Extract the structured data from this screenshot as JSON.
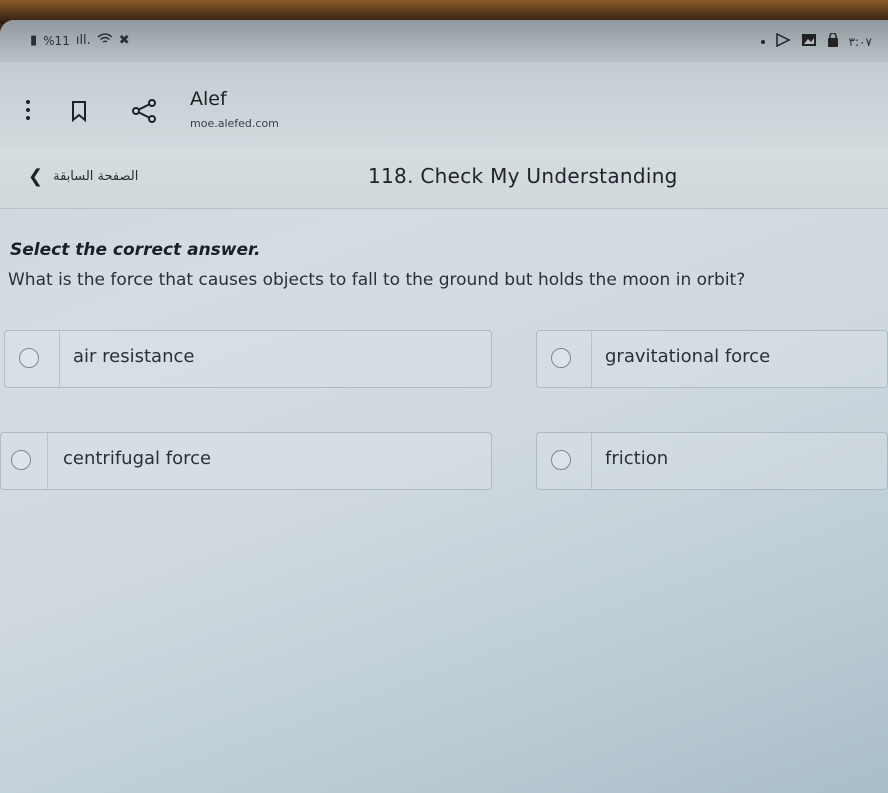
{
  "status_bar": {
    "battery_percent": "%11",
    "time": "٣:٠٧"
  },
  "app_header": {
    "site_name": "Alef",
    "site_url": "moe.alefed.com"
  },
  "nav": {
    "back_label": "الصفحة السابقة",
    "lesson_title": "118. Check My Understanding"
  },
  "quiz": {
    "instruction": "Select the correct answer.",
    "question": "What is the force that causes objects to fall to the ground but holds the moon in orbit?",
    "options": [
      {
        "label": "air resistance",
        "selected": false
      },
      {
        "label": "gravitational force",
        "selected": false
      },
      {
        "label": "centrifugal force",
        "selected": false
      },
      {
        "label": "friction",
        "selected": false
      }
    ]
  }
}
